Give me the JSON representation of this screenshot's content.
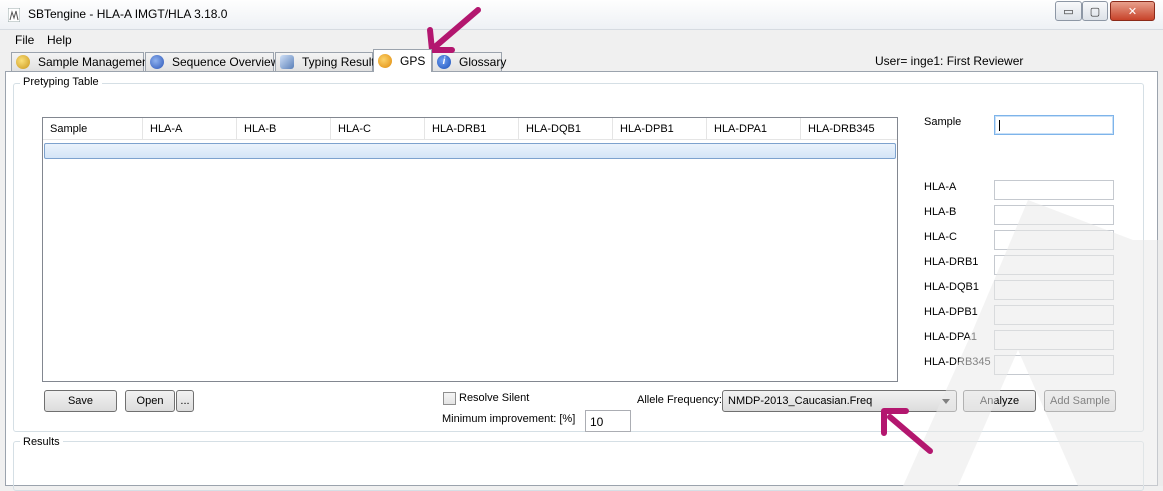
{
  "window": {
    "title": "SBTengine - HLA-A IMGT/HLA 3.18.0",
    "controls": {
      "minimize": "▭",
      "maximize": "▢",
      "close": "✕"
    }
  },
  "menu": {
    "file": "File",
    "help": "Help"
  },
  "tabs": [
    {
      "label": "Sample Management",
      "icon": "sample-management-icon",
      "active": false
    },
    {
      "label": "Sequence Overview",
      "icon": "sequence-overview-icon",
      "active": false
    },
    {
      "label": "Typing Result",
      "icon": "typing-result-icon",
      "active": false
    },
    {
      "label": "GPS",
      "icon": "gps-icon",
      "active": true
    },
    {
      "label": "Glossary",
      "icon": "info-icon",
      "active": false
    }
  ],
  "user_info": "User= inge1: First Reviewer",
  "pretyping": {
    "group_label": "Pretyping Table",
    "columns": [
      "Sample",
      "HLA-A",
      "HLA-B",
      "HLA-C",
      "HLA-DRB1",
      "HLA-DQB1",
      "HLA-DPB1",
      "HLA-DPA1",
      "HLA-DRB345"
    ]
  },
  "fields": {
    "sample_label": "Sample",
    "loci": [
      "HLA-A",
      "HLA-B",
      "HLA-C",
      "HLA-DRB1",
      "HLA-DQB1",
      "HLA-DPB1",
      "HLA-DPA1",
      "HLA-DRB345"
    ]
  },
  "buttons": {
    "save": "Save",
    "open": "Open",
    "browse": "...",
    "analyze": "Analyze",
    "add_sample": "Add Sample"
  },
  "options": {
    "resolve_silent": "Resolve Silent",
    "min_improvement_label": "Minimum improvement: [%]",
    "min_improvement_value": "10",
    "allele_frequency_label": "Allele Frequency:",
    "allele_frequency_value": "NMDP-2013_Caucasian.Freq"
  },
  "results": {
    "group_label": "Results"
  },
  "colors": {
    "annotation_arrow": "#b3176f",
    "selected_row": "#d4e5f7",
    "close_button": "#c7432a"
  }
}
